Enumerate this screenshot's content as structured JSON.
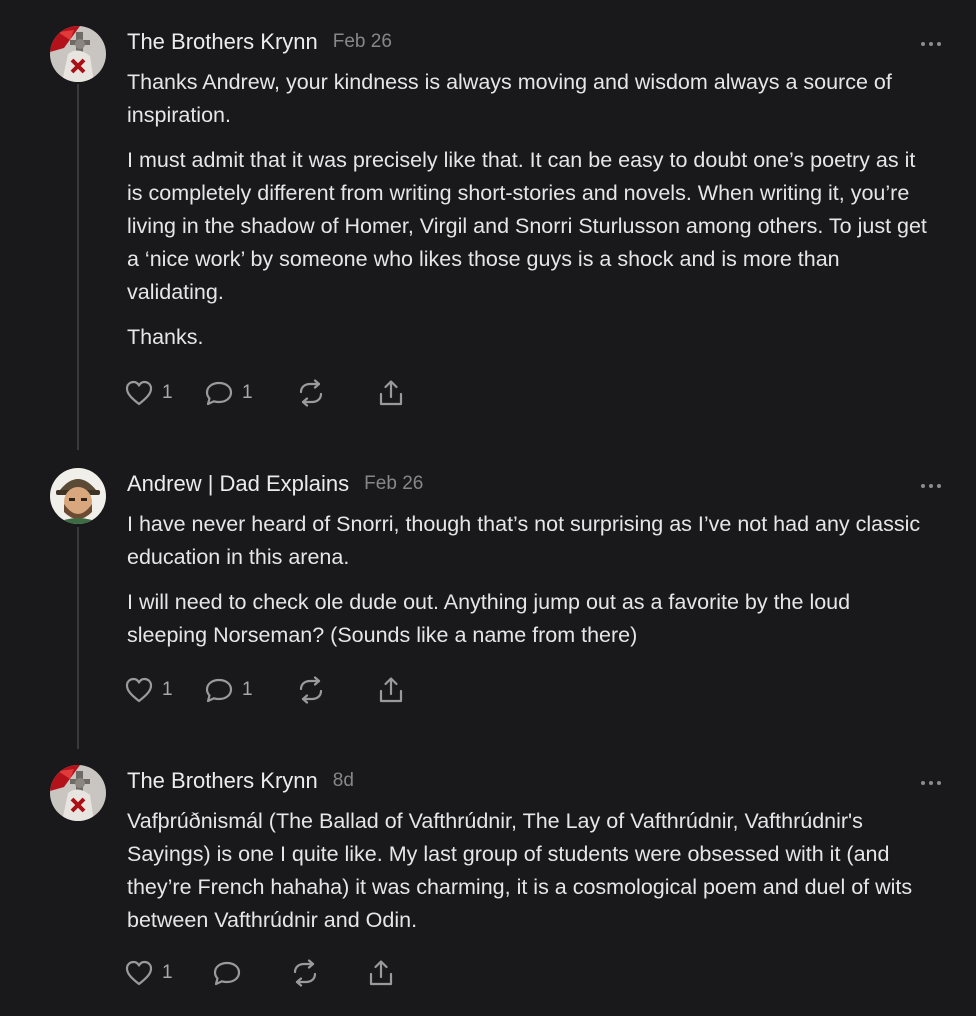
{
  "comments": [
    {
      "author": "The Brothers Krynn",
      "date": "Feb 26",
      "paragraphs": [
        "Thanks Andrew, your kindness is always moving and wisdom always a source of inspiration.",
        "I must admit that it was precisely like that. It can be easy to doubt one’s poetry as it is completely different from writing short-stories and novels. When writing it, you’re living in the shadow of Homer, Virgil and Snorri Sturlusson among others. To just get a ‘nice work’ by someone who likes those guys is a shock and is more than validating.",
        "Thanks."
      ],
      "likes": "1",
      "replies": "1"
    },
    {
      "author": "Andrew | Dad Explains",
      "date": "Feb 26",
      "paragraphs": [
        "I have never heard of Snorri, though that’s not surprising as I’ve not had any classic education in this arena.",
        "I will need to check ole dude out. Anything jump out as a favorite by the loud sleeping Norseman? (Sounds like a name from there)"
      ],
      "likes": "1",
      "replies": "1"
    },
    {
      "author": "The Brothers Krynn",
      "date": "8d",
      "paragraphs": [
        "Vafþrúðnismál (The Ballad of Vafthrúdnir, The Lay of Vafthrúdnir, Vafthrúdnir's Sayings) is one I quite like. My last group of students were obsessed with it (and they’re French hahaha) it was charming, it is a cosmological poem and duel of wits between Vafthrúdnir and Odin."
      ],
      "likes": "1",
      "replies": ""
    }
  ],
  "icons": {
    "like": "heart-icon",
    "reply": "speech-bubble-icon",
    "restack": "restack-icon",
    "share": "share-icon",
    "more": "ellipsis-icon"
  },
  "colors": {
    "background": "#19191b",
    "text": "#e6e6e8",
    "muted": "#87878b",
    "thread_line": "#3a3a3d"
  }
}
